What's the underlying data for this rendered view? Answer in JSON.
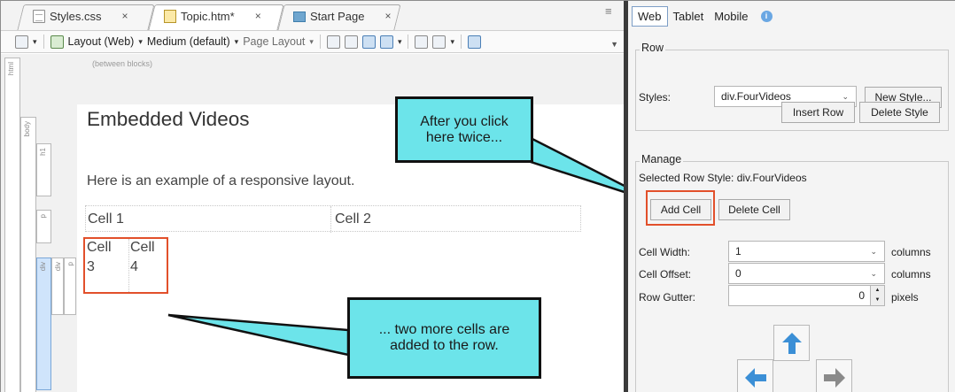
{
  "tabs": [
    {
      "label": "Styles.css",
      "close": "×"
    },
    {
      "label": "Topic.htm*",
      "close": "×"
    },
    {
      "label": "Start Page",
      "close": "×"
    }
  ],
  "toolbar": {
    "layout_web": "Layout (Web)",
    "medium": "Medium (default)",
    "page_layout": "Page Layout"
  },
  "editor": {
    "hint": "(between blocks)",
    "struct_labels": {
      "html": "html",
      "body": "body",
      "h1": "h1",
      "p1": "p",
      "p2": "p",
      "div1": "div",
      "div2": "div",
      "p3": "p"
    },
    "heading": "Embedded Videos",
    "paragraph": "Here is an example of a responsive layout.",
    "cell1": "Cell 1",
    "cell2": "Cell 2",
    "cell3_a": "Cell",
    "cell3_b": "3",
    "cell4_a": "Cell",
    "cell4_b": "4"
  },
  "callouts": {
    "first": "After you click\nhere twice...",
    "second": "... two more cells are\nadded to the row."
  },
  "panel": {
    "tabs": [
      "Web",
      "Tablet",
      "Mobile"
    ],
    "row_group": {
      "title": "Row",
      "styles_label": "Styles:",
      "styles_value": "div.FourVideos",
      "new_style": "New Style...",
      "insert_row": "Insert Row",
      "delete_style": "Delete Style"
    },
    "manage_group": {
      "title": "Manage",
      "selected_row_style": "Selected Row Style: div.FourVideos",
      "add_cell": "Add Cell",
      "delete_cell": "Delete Cell",
      "cell_width_label": "Cell Width:",
      "cell_width_value": "1",
      "cell_width_unit": "columns",
      "cell_offset_label": "Cell Offset:",
      "cell_offset_value": "0",
      "cell_offset_unit": "columns",
      "row_gutter_label": "Row Gutter:",
      "row_gutter_value": "0",
      "row_gutter_unit": "pixels"
    }
  },
  "colors": {
    "callout_fill": "#6ce4ea",
    "highlight_border": "#e2502b",
    "arrow_blue": "#3b8fd6",
    "arrow_gray": "#8a8a8a"
  }
}
